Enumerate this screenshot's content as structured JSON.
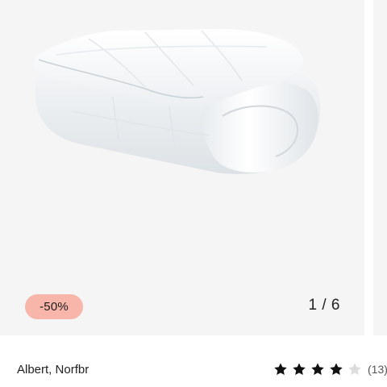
{
  "product": {
    "image_alt": "White folded duvet",
    "discount_badge": "-50%",
    "image_counter": "1 / 6",
    "brand": "Albert, Norfbr",
    "rating": {
      "stars_filled": 4,
      "stars_total": 5,
      "review_count": "(13)"
    }
  },
  "colors": {
    "badge_bg": "#f8b6aa",
    "gallery_bg": "#f5f5f6",
    "star_filled": "#111111",
    "star_empty": "#dcdcdc"
  },
  "icons": {
    "star": "star-icon"
  }
}
